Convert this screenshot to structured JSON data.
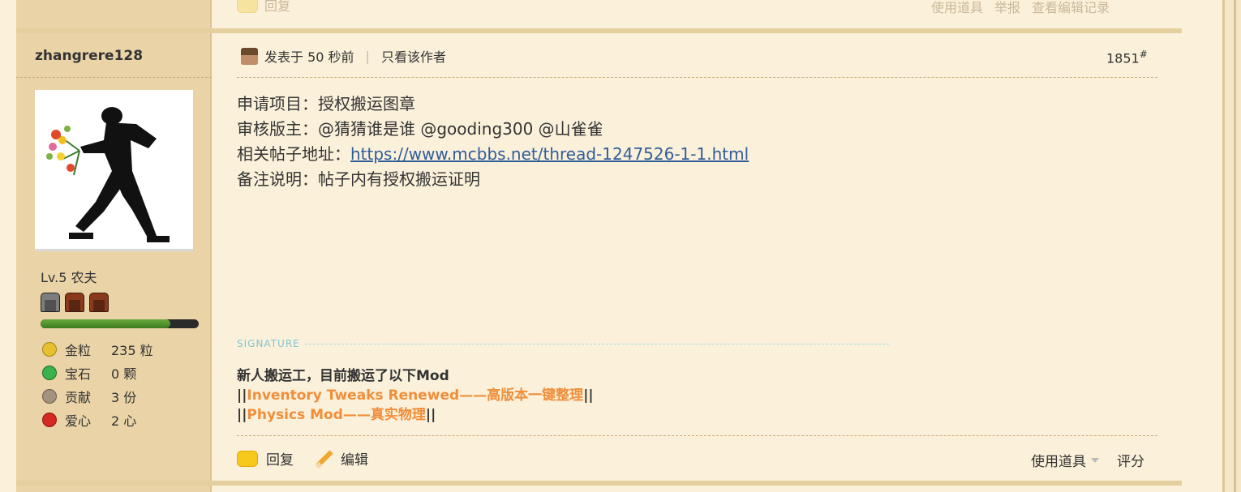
{
  "previous_post": {
    "reply_label": "回复",
    "tools_label": "使用道具",
    "report_label": "举报",
    "edit_history_label": "查看编辑记录"
  },
  "author": {
    "username": "zhangrere128",
    "level": "Lv.5 农夫",
    "xp_fraction": 0.82,
    "stats": [
      {
        "label": "金粒",
        "value": "235 粒",
        "icon": "gold-nugget-icon"
      },
      {
        "label": "宝石",
        "value": "0 颗",
        "icon": "emerald-icon"
      },
      {
        "label": "贡献",
        "value": "3 份",
        "icon": "contribution-icon"
      },
      {
        "label": "爱心",
        "value": "2 心",
        "icon": "apple-heart-icon"
      }
    ]
  },
  "post": {
    "posted_time": "发表于 50 秒前",
    "author_only_label": "只看该作者",
    "floor": "1851",
    "floor_mark": "#",
    "lines": {
      "apply_label": "申请项目：授权搬运图章",
      "reviewers": "审核版主：@猜猜谁是谁 @gooding300 @山雀雀",
      "thread_label": "相关帖子地址：",
      "thread_url": "https://www.mcbbs.net/thread-1247526-1-1.html",
      "note": "备注说明：帖子内有授权搬运证明"
    },
    "signature": {
      "label": "SIGNATURE",
      "line1": "新人搬运工，目前搬运了以下Mod",
      "line2_prefix": "||",
      "line2_link": "Inventory Tweaks Renewed——高版本一键整理",
      "line2_suffix": "||",
      "line3_prefix": "||",
      "line3_link": "Physics Mod——真实物理",
      "line3_suffix": "||"
    }
  },
  "footer": {
    "reply_label": "回复",
    "edit_label": "编辑",
    "tools_label": "使用道具",
    "rate_label": "评分"
  }
}
